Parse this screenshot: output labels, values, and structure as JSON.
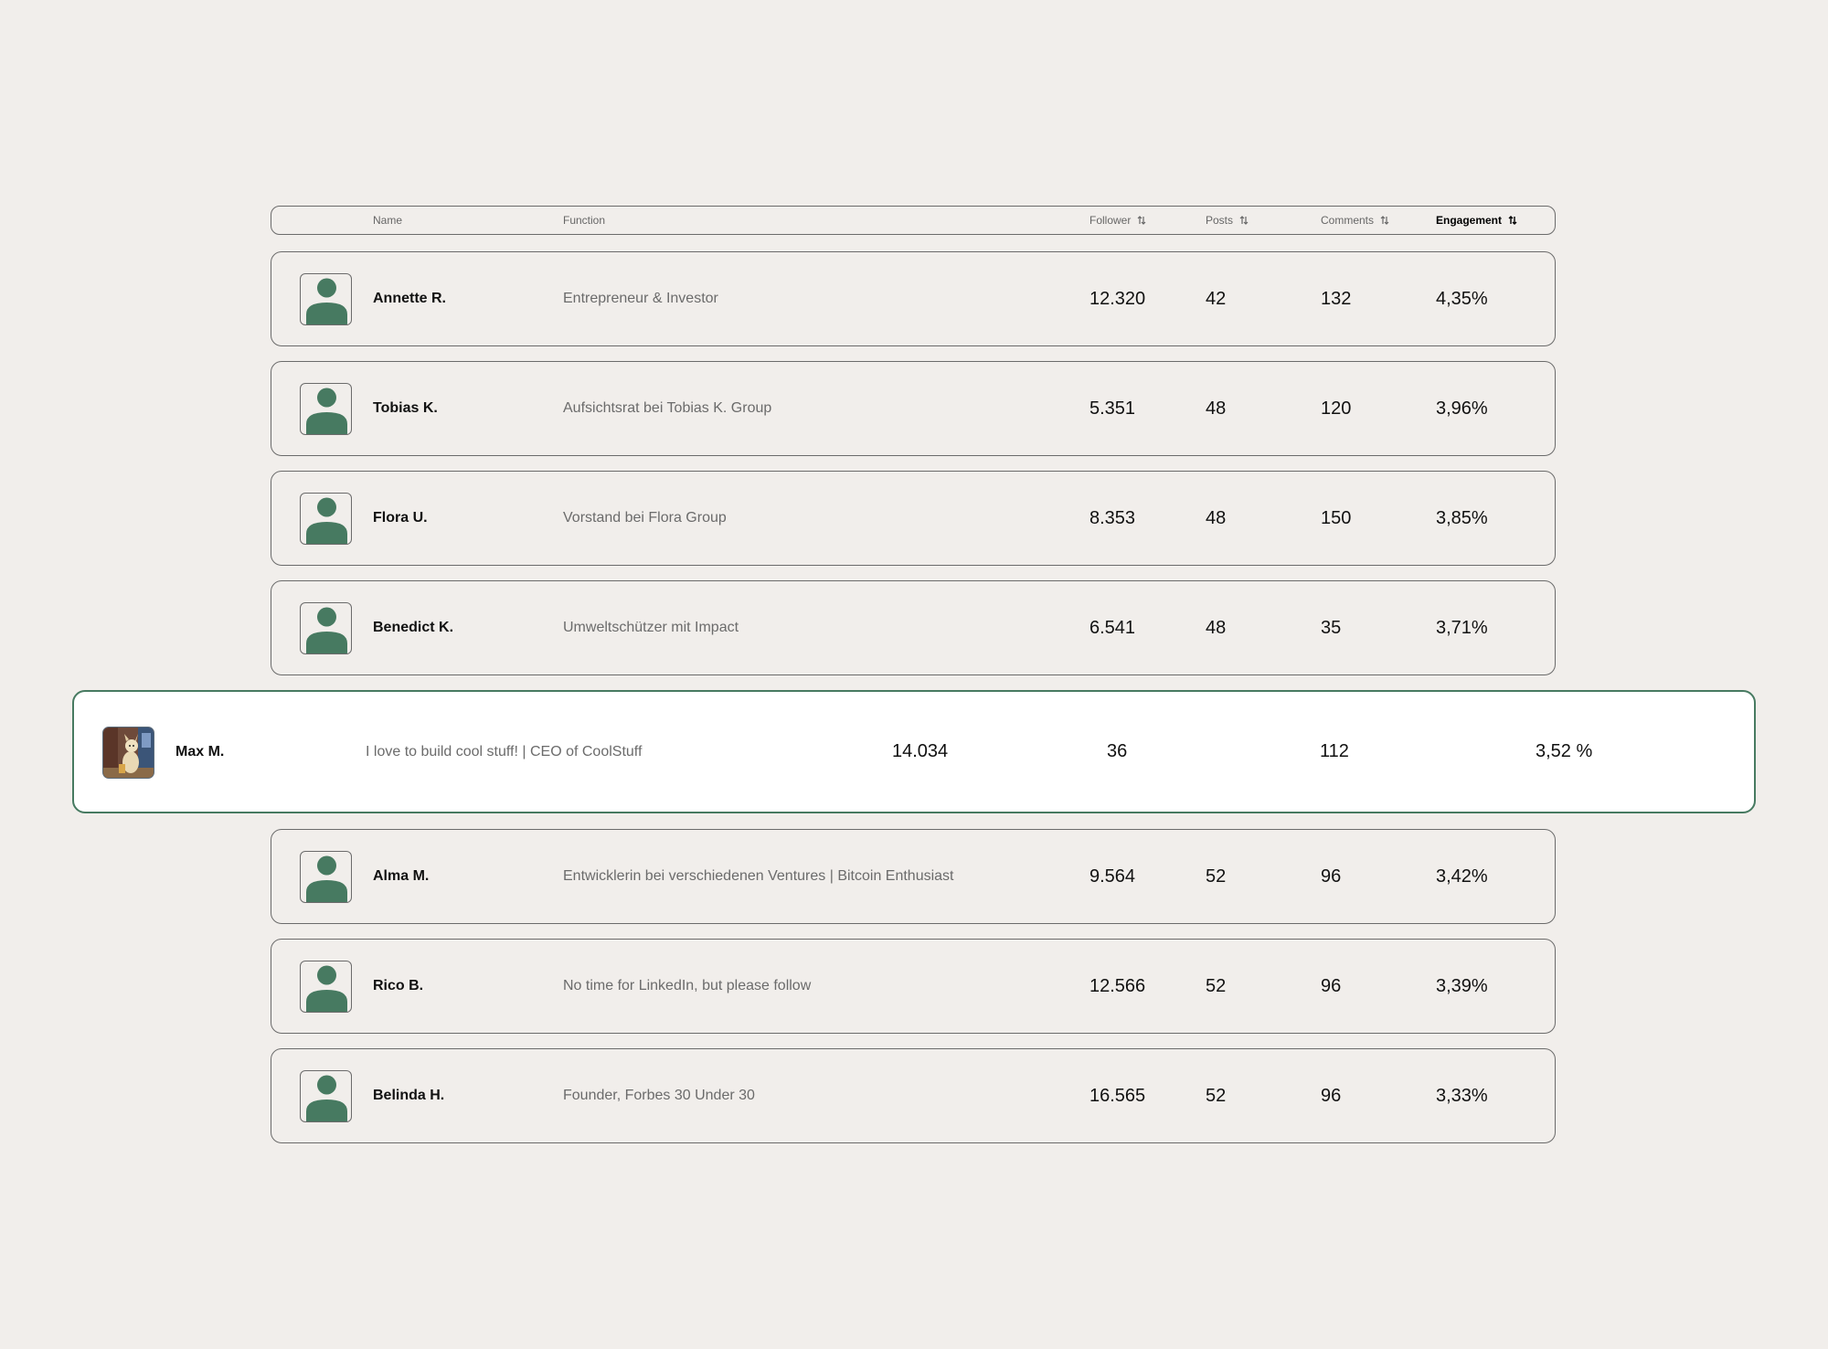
{
  "header": {
    "name": "Name",
    "function": "Function",
    "follower": "Follower",
    "posts": "Posts",
    "comments": "Comments",
    "engagement": "Engagement",
    "active_sort": "engagement"
  },
  "rows_top": [
    {
      "name": "Annette R.",
      "function": "Entrepreneur & Investor",
      "follower": "12.320",
      "posts": "42",
      "comments": "132",
      "engagement": "4,35%"
    },
    {
      "name": "Tobias K.",
      "function": "Aufsichtsrat bei Tobias K. Group",
      "follower": "5.351",
      "posts": "48",
      "comments": "120",
      "engagement": "3,96%"
    },
    {
      "name": "Flora U.",
      "function": "Vorstand bei Flora Group",
      "follower": "8.353",
      "posts": "48",
      "comments": "150",
      "engagement": "3,85%"
    },
    {
      "name": "Benedict K.",
      "function": "Umweltschützer mit Impact",
      "follower": "6.541",
      "posts": "48",
      "comments": "35",
      "engagement": "3,71%"
    }
  ],
  "highlighted_row": {
    "name": "Max M.",
    "function": "I love to build cool stuff! | CEO of CoolStuff",
    "follower": "14.034",
    "posts": "36",
    "comments": "112",
    "engagement": "3,52 %",
    "avatar_icon": "profile-photo-dog"
  },
  "rows_bottom": [
    {
      "name": "Alma M.",
      "function": "Entwicklerin bei verschiedenen Ventures | Bitcoin Enthusiast",
      "follower": "9.564",
      "posts": "52",
      "comments": "96",
      "engagement": "3,42%"
    },
    {
      "name": "Rico B.",
      "function": "No time for LinkedIn, but please follow",
      "follower": "12.566",
      "posts": "52",
      "comments": "96",
      "engagement": "3,39%"
    },
    {
      "name": "Belinda H.",
      "function": "Founder, Forbes 30 Under 30",
      "follower": "16.565",
      "posts": "52",
      "comments": "96",
      "engagement": "3,33%"
    }
  ],
  "colors": {
    "background": "#f1eeeb",
    "accent_green": "#477a61",
    "border": "#6b6b6b",
    "muted_text": "#6b6b6b"
  }
}
